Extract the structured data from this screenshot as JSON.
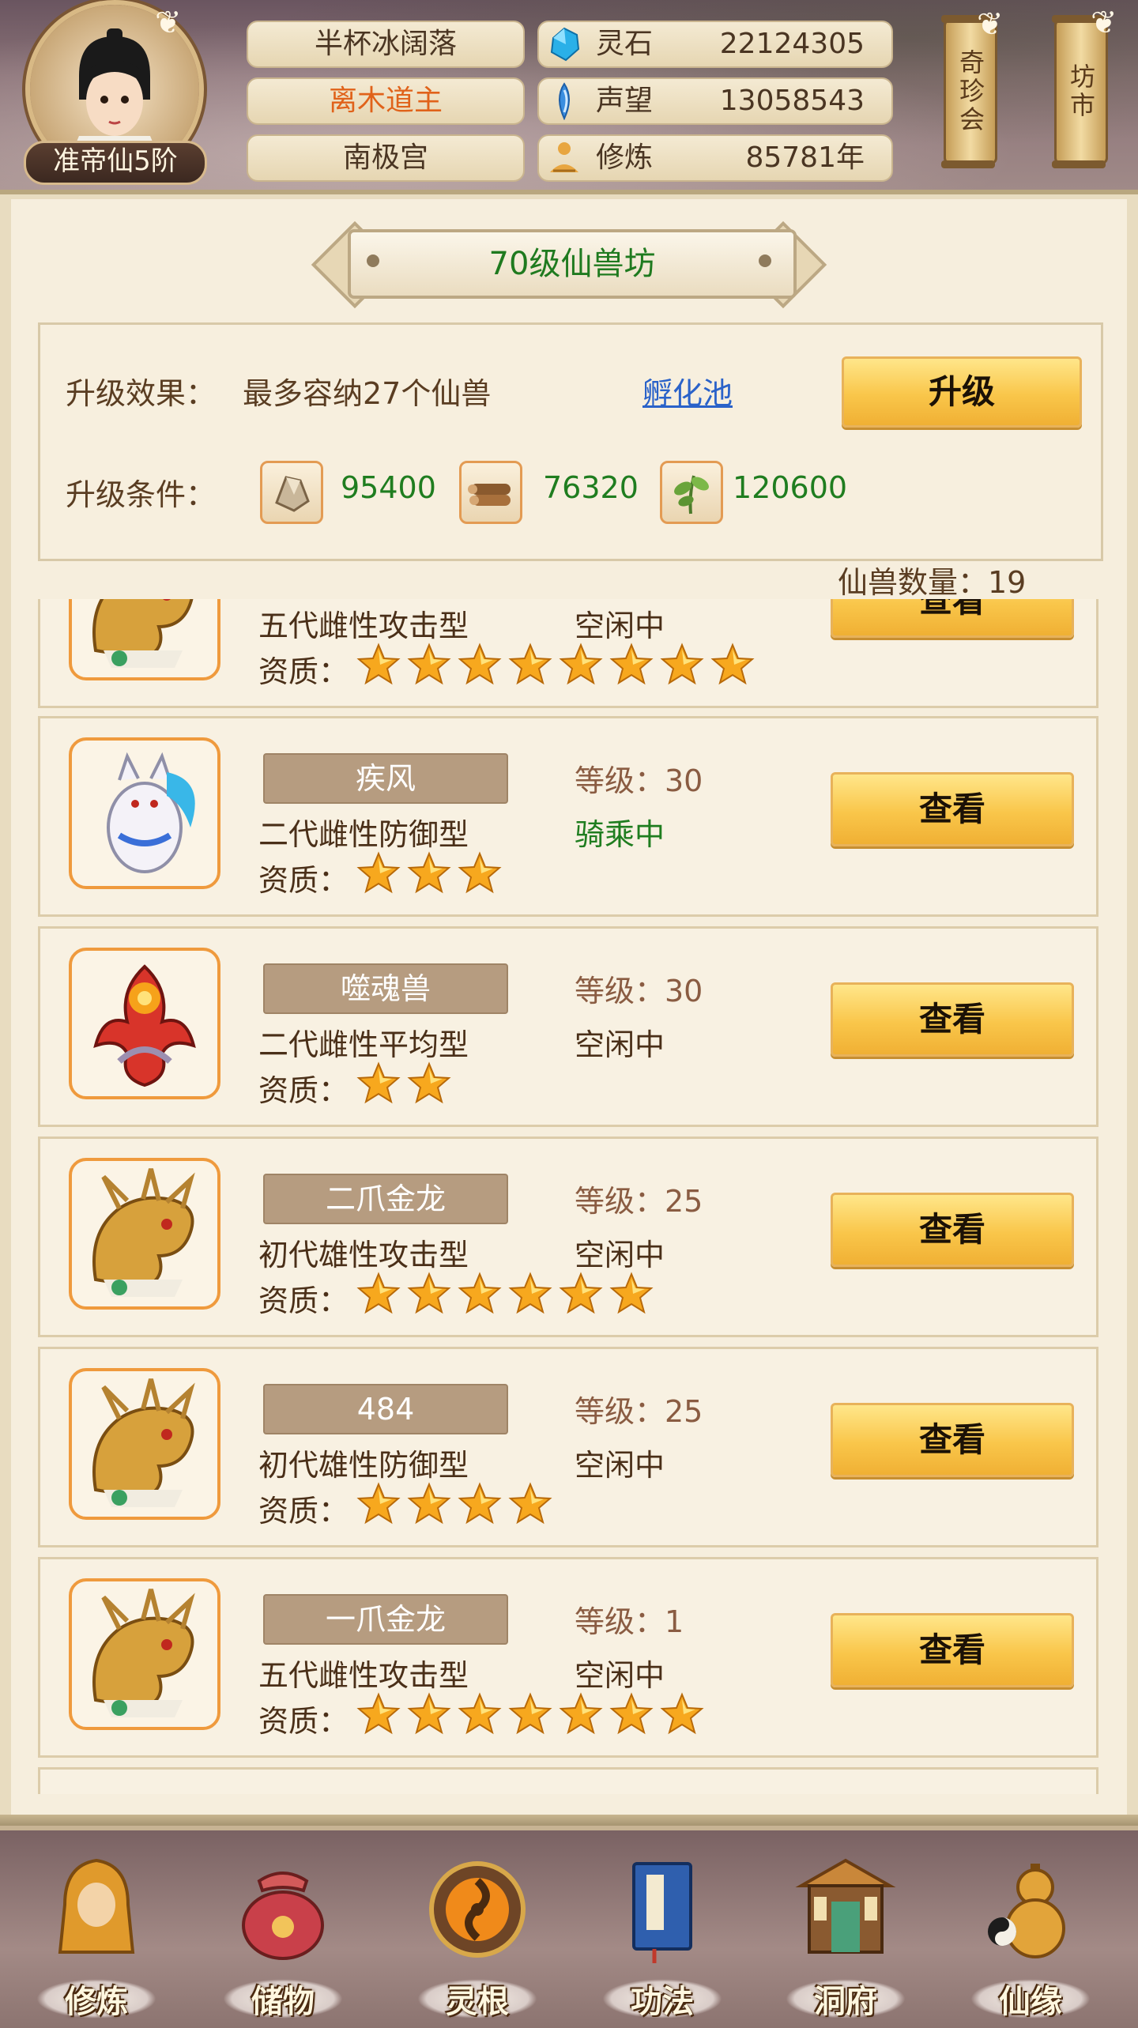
{
  "header": {
    "rank": "准帝仙5阶",
    "player_name": "半杯冰阔落",
    "title": "离木道主",
    "sect": "南极宫",
    "resources": [
      {
        "icon": "spirit-stone-icon",
        "label": "灵石",
        "value": "22124305"
      },
      {
        "icon": "reputation-icon",
        "label": "声望",
        "value": "13058543"
      },
      {
        "icon": "cultivation-icon",
        "label": "修炼",
        "value": "85781年"
      }
    ],
    "lanterns": [
      "奇珍会",
      "坊市"
    ]
  },
  "building": {
    "title": "70级仙兽坊",
    "effect_label": "升级效果：",
    "effect_text": "最多容纳27个仙兽",
    "hatch_link": "孵化池",
    "upgrade_button": "升级",
    "condition_label": "升级条件：",
    "materials": [
      {
        "icon": "ore-icon",
        "amount": "95400"
      },
      {
        "icon": "wood-icon",
        "amount": "76320"
      },
      {
        "icon": "herb-icon",
        "amount": "120600"
      }
    ],
    "beast_count_label": "仙兽数量：19"
  },
  "beasts": [
    {
      "name": "",
      "type": "五代雌性攻击型",
      "level": "",
      "state": "空闲中",
      "quality_label": "资质：",
      "stars": 8,
      "button": "查看",
      "portrait": "golden-dragon"
    },
    {
      "name": "疾风",
      "type": "二代雌性防御型",
      "level": "等级：30",
      "state": "骑乘中",
      "quality_label": "资质：",
      "stars": 3,
      "button": "查看",
      "portrait": "white-wolf"
    },
    {
      "name": "噬魂兽",
      "type": "二代雌性平均型",
      "level": "等级：30",
      "state": "空闲中",
      "quality_label": "资质：",
      "stars": 2,
      "button": "查看",
      "portrait": "red-spirit"
    },
    {
      "name": "二爪金龙",
      "type": "初代雄性攻击型",
      "level": "等级：25",
      "state": "空闲中",
      "quality_label": "资质：",
      "stars": 6,
      "button": "查看",
      "portrait": "golden-dragon"
    },
    {
      "name": "484",
      "type": "初代雄性防御型",
      "level": "等级：25",
      "state": "空闲中",
      "quality_label": "资质：",
      "stars": 4,
      "button": "查看",
      "portrait": "golden-dragon"
    },
    {
      "name": "一爪金龙",
      "type": "五代雌性攻击型",
      "level": "等级：1",
      "state": "空闲中",
      "quality_label": "资质：",
      "stars": 7,
      "button": "查看",
      "portrait": "golden-dragon"
    }
  ],
  "bottom_nav": [
    {
      "label": "修炼",
      "icon": "monk-icon"
    },
    {
      "label": "储物",
      "icon": "bag-icon"
    },
    {
      "label": "灵根",
      "icon": "spirit-root-icon"
    },
    {
      "label": "功法",
      "icon": "book-icon"
    },
    {
      "label": "洞府",
      "icon": "palace-icon"
    },
    {
      "label": "仙缘",
      "icon": "gourd-icon"
    }
  ],
  "colors": {
    "gold_button": "#f9c64a",
    "green_text": "#1f7d1f",
    "link_blue": "#2a62c9",
    "portrait_border": "#ef9a3d",
    "name_tag": "#b69c80"
  }
}
